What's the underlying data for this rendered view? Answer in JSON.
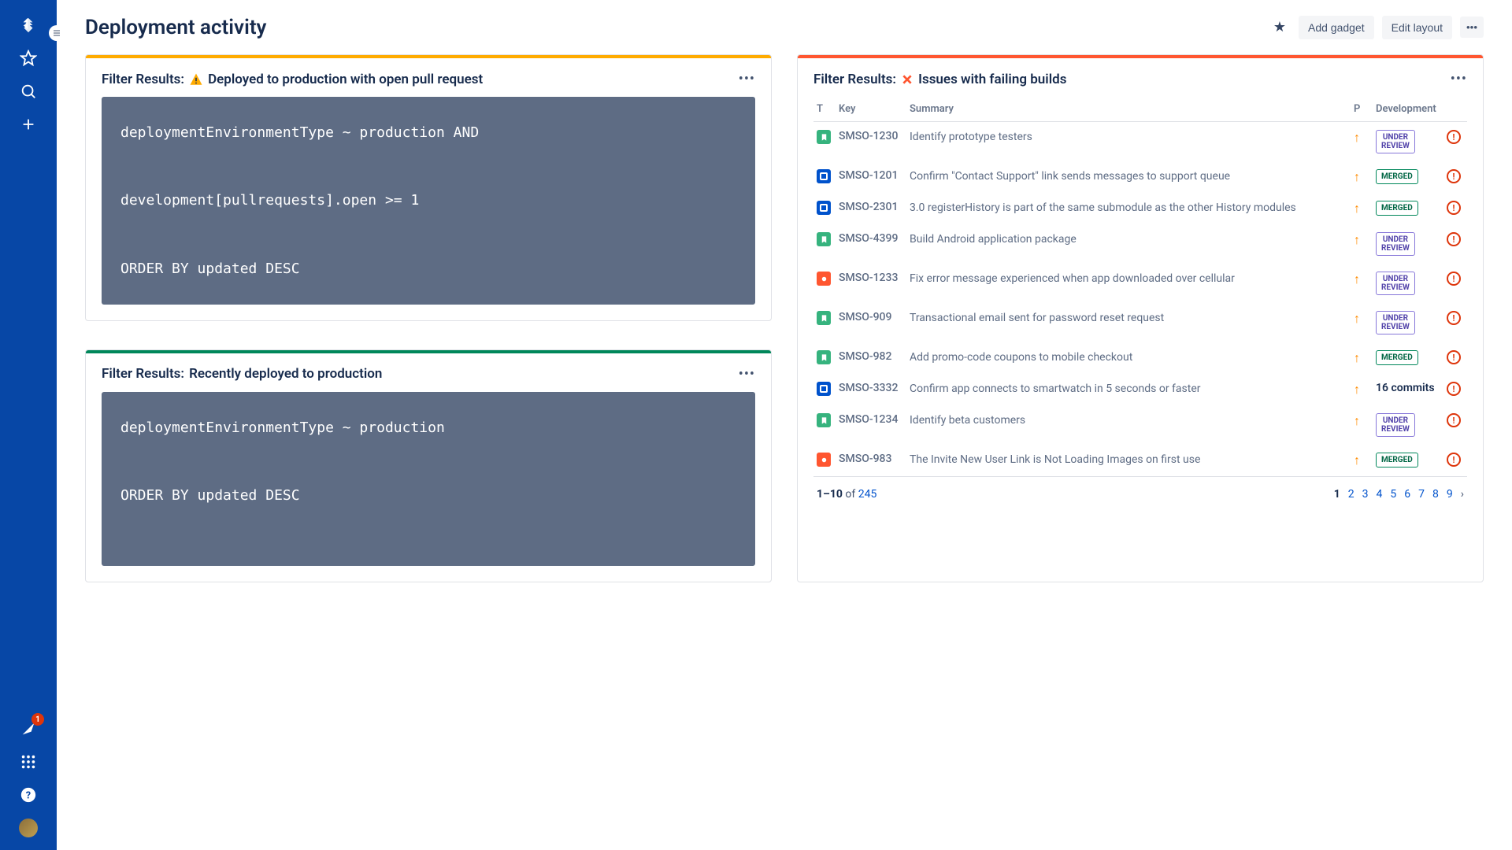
{
  "header": {
    "title": "Deployment activity",
    "add_gadget": "Add gadget",
    "edit_layout": "Edit layout"
  },
  "sidebar": {
    "notif_count": "1"
  },
  "card1": {
    "prefix": "Filter Results:",
    "title": "Deployed to production with open pull request",
    "code": "deploymentEnvironmentType ~ production AND\n\ndevelopment[pullrequests].open >= 1\n\nORDER BY updated DESC"
  },
  "card2": {
    "prefix": "Filter Results:",
    "title": "Recently deployed to production",
    "code": "deploymentEnvironmentType ~ production\n\nORDER BY updated DESC\n\n"
  },
  "issues": {
    "prefix": "Filter Results:",
    "title": "Issues with failing builds",
    "columns": {
      "t": "T",
      "key": "Key",
      "summary": "Summary",
      "p": "P",
      "dev": "Development"
    },
    "rows": [
      {
        "type": "story",
        "key": "SMSO-1230",
        "summary": "Identify prototype testers",
        "dev": "UNDER REVIEW",
        "dev_kind": "review"
      },
      {
        "type": "task",
        "key": "SMSO-1201",
        "summary": "Confirm \"Contact Support\" link sends messages to support queue",
        "dev": "MERGED",
        "dev_kind": "merged"
      },
      {
        "type": "task",
        "key": "SMSO-2301",
        "summary": "3.0 registerHistory is part of the same submodule as the other History modules",
        "dev": "MERGED",
        "dev_kind": "merged"
      },
      {
        "type": "story",
        "key": "SMSO-4399",
        "summary": "Build Android application package",
        "dev": "UNDER REVIEW",
        "dev_kind": "review"
      },
      {
        "type": "bug",
        "key": "SMSO-1233",
        "summary": "Fix error message experienced when app downloaded over cellular",
        "dev": "UNDER REVIEW",
        "dev_kind": "review"
      },
      {
        "type": "story",
        "key": "SMSO-909",
        "summary": "Transactional email sent for password reset request",
        "dev": "UNDER REVIEW",
        "dev_kind": "review"
      },
      {
        "type": "story",
        "key": "SMSO-982",
        "summary": "Add promo-code coupons to mobile checkout",
        "dev": "MERGED",
        "dev_kind": "merged"
      },
      {
        "type": "task",
        "key": "SMSO-3332",
        "summary": "Confirm app connects to smartwatch in 5 seconds or faster",
        "dev": "16 commits",
        "dev_kind": "commits"
      },
      {
        "type": "story",
        "key": "SMSO-1234",
        "summary": "Identify beta customers",
        "dev": "UNDER REVIEW",
        "dev_kind": "review"
      },
      {
        "type": "bug",
        "key": "SMSO-983",
        "summary": "The Invite New User Link is Not Loading Images on first use",
        "dev": "MERGED",
        "dev_kind": "merged"
      }
    ],
    "pagination": {
      "range": "1–10",
      "of": "of",
      "total": "245",
      "pages": [
        "1",
        "2",
        "3",
        "4",
        "5",
        "6",
        "7",
        "8",
        "9"
      ],
      "active": "1"
    }
  }
}
